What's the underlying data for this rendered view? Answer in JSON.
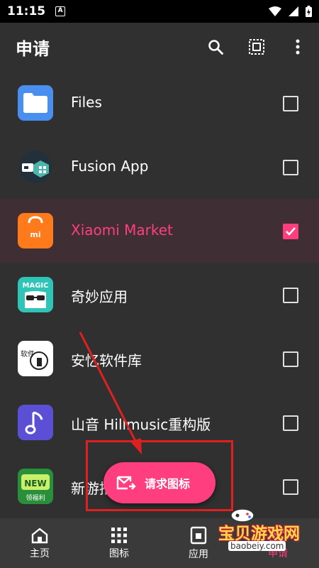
{
  "status_bar": {
    "time": "11:15",
    "notification_icon": "A"
  },
  "app_bar": {
    "title": "申请",
    "actions": [
      "search-icon",
      "select-all-icon",
      "more-vert-icon"
    ]
  },
  "apps": [
    {
      "label": "Files",
      "checked": false
    },
    {
      "label": "Fusion App",
      "checked": false
    },
    {
      "label": "Xiaomi Market",
      "checked": true
    },
    {
      "label": "奇妙应用",
      "checked": false,
      "icon_text": "MAGIC"
    },
    {
      "label": "安忆软件库",
      "checked": false,
      "icon_text": "软件"
    },
    {
      "label": "山音 Hillmusic重构版",
      "checked": false
    },
    {
      "label": "新游推",
      "checked": false,
      "icon_text": "NEW",
      "icon_subtext": "领福利"
    }
  ],
  "fab": {
    "label": "请求图标"
  },
  "nav": [
    {
      "label": "主页",
      "icon": "home-icon",
      "active": false
    },
    {
      "label": "图标",
      "icon": "grid-icon",
      "active": false
    },
    {
      "label": "应用",
      "icon": "apps-icon",
      "active": false
    },
    {
      "label": "申请",
      "icon": "request-icon",
      "active": true
    }
  ],
  "watermark": {
    "title": "宝贝游戏网",
    "url": "baobeiy.com"
  },
  "colors": {
    "accent": "#ff3e7f",
    "background": "#303030",
    "annotation": "#e02020"
  }
}
